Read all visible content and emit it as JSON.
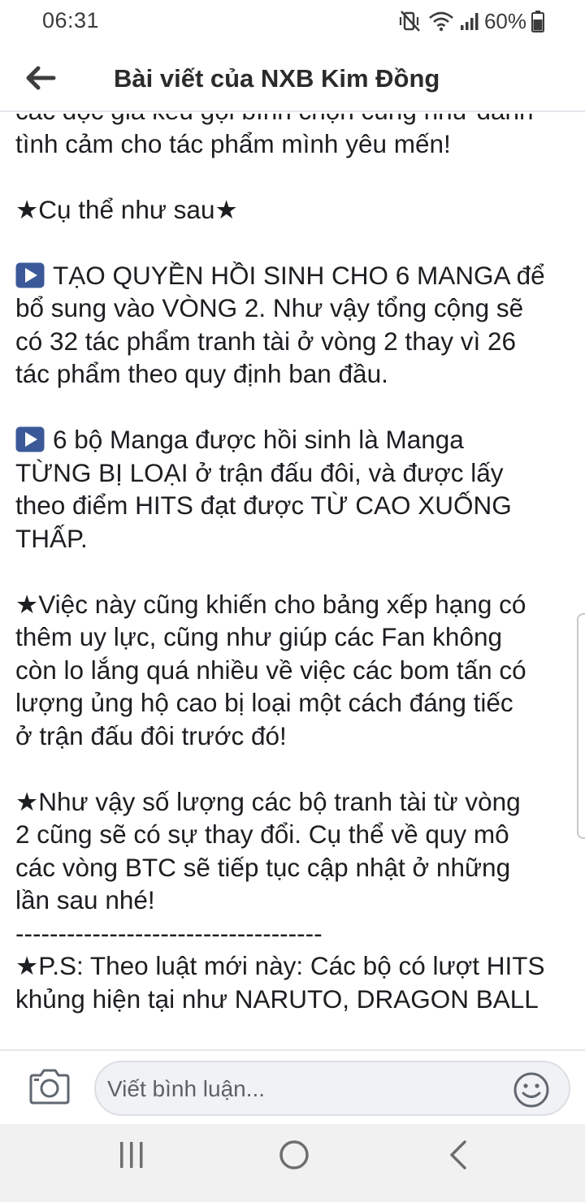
{
  "status_bar": {
    "time": "06:31",
    "battery_text": "60%",
    "icons": [
      "vibrate-mute-icon",
      "wifi-icon",
      "signal-icon",
      "battery-icon"
    ]
  },
  "header": {
    "back_icon": "arrow-left-icon",
    "title": "Bài viết của NXB Kim Đồng"
  },
  "post": {
    "lines": [
      "các độc giả kêu gọi bình chọn cũng như dành",
      "tình cảm cho tác phẩm mình yêu mến!",
      "",
      "★Cụ thể như sau★",
      "",
      "TẠO QUYỀN HỒI SINH CHO 6 MANGA để",
      "bổ sung vào VÒNG 2. Như vậy tổng cộng sẽ",
      "có 32 tác phẩm tranh tài ở vòng 2 thay vì 26",
      "tác phẩm theo quy định ban đầu.",
      "",
      "6 bộ Manga được hồi sinh là Manga",
      "TỪNG BỊ LOẠI ở trận đấu đôi, và được lấy",
      "theo điểm HITS đạt được TỪ CAO XUỐNG",
      "THẤP.",
      "",
      "★Việc này cũng khiến cho bảng xếp hạng có",
      "thêm uy lực, cũng như giúp các Fan không",
      "còn lo lắng quá nhiều về việc các bom tấn có",
      "lượng ủng hộ cao bị loại một cách đáng tiếc",
      "ở trận đấu đôi trước đó!",
      "",
      "★Như vậy số lượng các bộ tranh tài từ vòng",
      "2 cũng sẽ có sự thay đổi. Cụ thể về quy mô",
      "các vòng BTC sẽ tiếp tục cập nhật ở những",
      "lần sau nhé!",
      "------------------------------------",
      "★P.S: Theo luật mới này: Các bộ có lượt HITS",
      "khủng hiện tại như NARUTO, DRAGON BALL"
    ],
    "play_icon": "play-button-icon",
    "play_icon_color": "#3b5998"
  },
  "comment_bar": {
    "camera_icon": "camera-icon",
    "placeholder": "Viết bình luận...",
    "emoji_icon": "smiley-icon"
  },
  "nav_bar": {
    "icons": [
      "recents-icon",
      "home-icon",
      "back-icon"
    ]
  }
}
